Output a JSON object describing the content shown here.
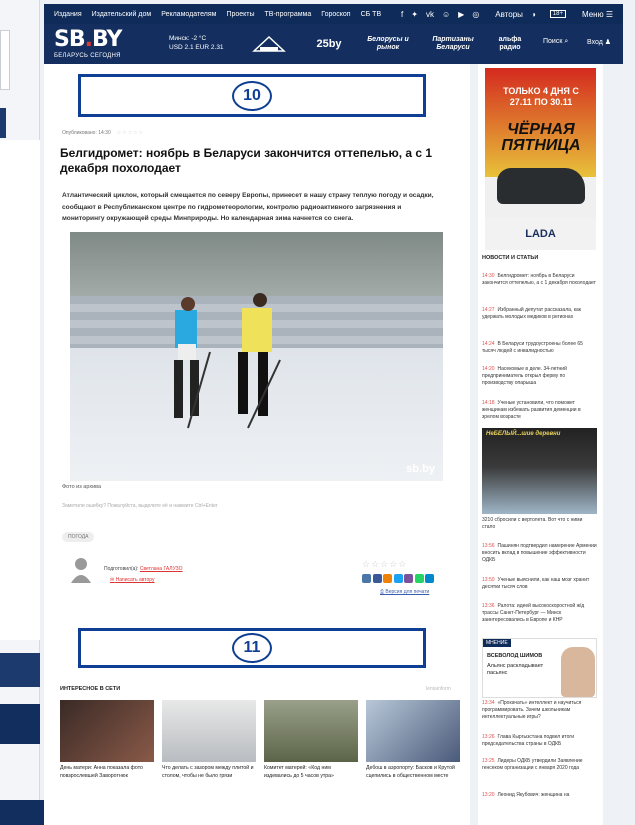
{
  "nav": {
    "items": [
      "Издания",
      "Издательский дом",
      "Рекламодателям",
      "Проекты",
      "ТВ-программа",
      "Гороскоп",
      "СБ ТВ"
    ],
    "authors": "Авторы",
    "age": "18+",
    "menu": "Меню"
  },
  "header": {
    "logo_main": "SB",
    "logo_dot": ".",
    "logo_tail": "BY",
    "logo_sub": "БЕЛАРУСЬ СЕГОДНЯ",
    "weather_city": "Минск: -2 °C",
    "weather_rates": "USD 2.1   EUR 2.31",
    "partners": [
      "25by",
      "Белорусы и рынок",
      "Партизаны Беларуси",
      "альфа радио"
    ],
    "search": "Поиск",
    "login": "Вход"
  },
  "banners": {
    "top_number": "10",
    "bottom_number": "11"
  },
  "article": {
    "published": "Опубликовано: 14:30",
    "title": "Белгидромет: ноябрь в Беларуси закончится оттепелью, а с 1 декабря похолодает",
    "lead": "Атлантический циклон, который смещается по северу Европы, принесет в нашу страну теплую погоду и осадки, сообщают в Республиканском центре по гидрометеорологии, контролю радиоактивного загрязнения и мониторингу окружающей среды Минприроды. Но календарная зима начнется со снега.",
    "photo_watermark": "sb.by",
    "photo_caption": "Фото из архива",
    "error_note": "Заметили ошибку? Пожалуйста, выделите её и нажмите Ctrl+Enter",
    "tag": "ПОГОДА",
    "prepared_label": "Подготовил(а):",
    "author_name": "Светлана ГАЛУЗО",
    "write_author": "Написать автору",
    "print": "Версия для печати"
  },
  "network": {
    "heading": "ИНТЕРЕСНОЕ В СЕТИ",
    "source": "lentainform",
    "cards": [
      {
        "text": "День матери: Анна показала фото повзрослевшей Заворотнюк"
      },
      {
        "text": "Что делать с зазором между плитой и столом, чтобы не было грязи"
      },
      {
        "text": "Комитет матерей: «Код ним издевались до 5 часов утра»"
      },
      {
        "text": "Дебош в аэропорту: Басков и Крутой сцепились в общественном месте"
      }
    ]
  },
  "sidebar": {
    "ad_line1": "ТОЛЬКО 4 ДНЯ С 27.11 ПО 30.11",
    "ad_line2": "ЧЁРНАЯ ПЯТНИЦА",
    "ad_brand": "LADA",
    "news_heading": "НОВОСТИ И СТАТЬИ",
    "news": [
      {
        "time": "14:30",
        "text": "Белгидромет: ноябрь в Беларуси закончится оттепелью, а с 1 декабря похолодает"
      },
      {
        "time": "14:27",
        "text": "Избранный депутат рассказала, как удержать молодых медиков в регионах"
      },
      {
        "time": "14:24",
        "text": "В Беларуси трудоустроены более 65 тысяч людей с инвалидностью"
      },
      {
        "time": "14:20",
        "text": "Насекомые в деле. 34-летний предприниматель открыл ферму по производству опарыша"
      },
      {
        "time": "14:18",
        "text": "Ученые установили, что поможет женщинам избежать развития деменции в зрелом возрасте"
      }
    ],
    "photo_caption": "НеБЕЛЫЙ...шие деревни",
    "photo_news": "3210 сбросили с вертолета. Вот что с ними стало",
    "news2": [
      {
        "time": "13:56",
        "text": "Пашинян подтвердил намерение Армении вносить вклад в повышение эффективности ОДКБ"
      },
      {
        "time": "13:50",
        "text": "Ученые выяснили, как наш мозг хранит десятки тысяч слов"
      },
      {
        "time": "13:36",
        "text": "Ралота: идеей высокоскоростной ж/д трассы Санкт-Петербург — Минск заинтересовались в Европе и КНР"
      }
    ],
    "opinion_label": "МНЕНИЕ",
    "opinion_name": "ВСЕВОЛОД ШИМОВ",
    "opinion_quote": "Альянс раскладывает пасьянс",
    "news3": [
      {
        "time": "13:34",
        "text": "«Прокачать» интеллект и научиться программировать. Зачем школьникам интеллектуальные игры?"
      },
      {
        "time": "13:26",
        "text": "Глава Кыргызстана подвел итоги председательства страны в ОДКБ"
      },
      {
        "time": "13:25",
        "text": "Лидеры ОДКБ утвердили Заявление генсеком организации с января 2020 года"
      },
      {
        "time": "13:20",
        "text": "Леонид Якубович: женщина на"
      }
    ]
  },
  "colors": {
    "navy": "#0f2b5a",
    "accent_red": "#e03a2f",
    "banner_blue": "#0f3f94"
  }
}
